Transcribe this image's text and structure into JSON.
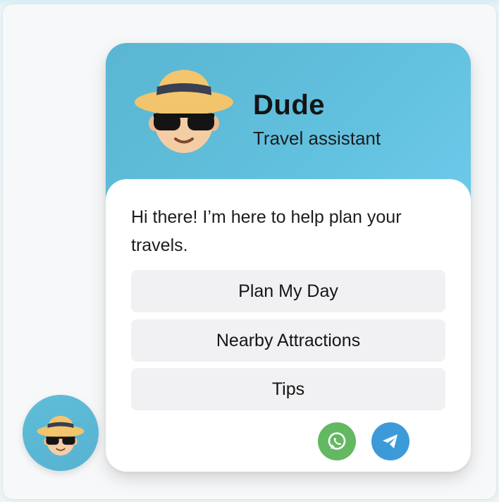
{
  "assistant": {
    "name": "Dude",
    "subtitle": "Travel assistant"
  },
  "chat": {
    "greeting": "Hi there! I’m here to help plan your travels."
  },
  "options": [
    {
      "label": "Plan My Day"
    },
    {
      "label": "Nearby Attractions"
    },
    {
      "label": "Tips"
    }
  ],
  "contacts": {
    "whatsapp_icon": "whatsapp-icon",
    "telegram_icon": "telegram-icon"
  },
  "colors": {
    "header_accent": "#5ab6d2",
    "whatsapp": "#63b862",
    "telegram": "#3d9ad8"
  }
}
